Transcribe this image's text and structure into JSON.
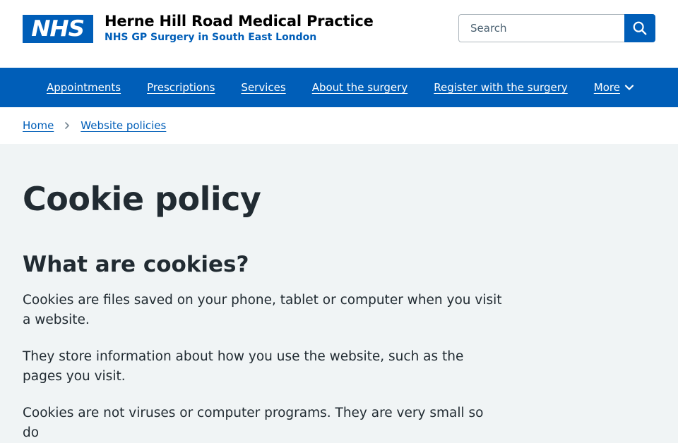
{
  "header": {
    "logo_text": "NHS",
    "org_name": "Herne Hill Road Medical Practice",
    "org_desc": "NHS GP Surgery in South East London",
    "search_placeholder": "Search"
  },
  "nav": {
    "items": [
      "Appointments",
      "Prescriptions",
      "Services",
      "About the surgery",
      "Register with the surgery"
    ],
    "more_label": "More"
  },
  "breadcrumb": {
    "home": "Home",
    "current": "Website policies"
  },
  "content": {
    "title": "Cookie policy",
    "section_heading": "What are cookies?",
    "paragraphs": [
      "Cookies are files saved on your phone, tablet or computer when you visit a website.",
      "They store information about how you use the website, such as the pages you visit.",
      "Cookies are not viruses or computer programs. They are very small so do"
    ]
  },
  "colors": {
    "brand_blue": "#005eb8",
    "page_bg": "#f0f4f5",
    "text": "#212b32"
  }
}
